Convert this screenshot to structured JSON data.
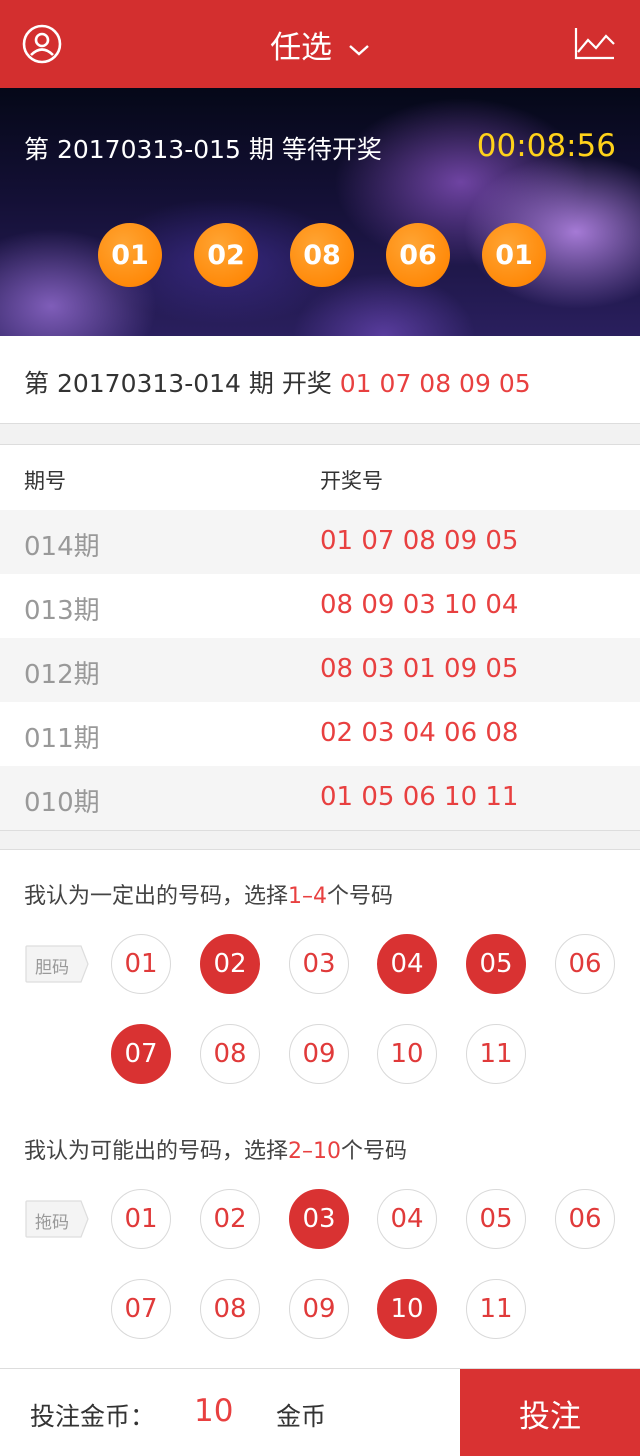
{
  "header": {
    "title": "任选"
  },
  "banner": {
    "period_text": "第 20170313-015 期 等待开奖",
    "countdown": "00:08:56",
    "balls": [
      "01",
      "02",
      "08",
      "06",
      "01"
    ]
  },
  "last_result": {
    "prefix": "第 20170313-014 期 开奖 ",
    "numbers": "01 07 08 09 05"
  },
  "history": {
    "col_period": "期号",
    "col_numbers": "开奖号",
    "rows": [
      {
        "period": "014期",
        "numbers": "01 07 08 09 05"
      },
      {
        "period": "013期",
        "numbers": "08 09 03 10 04"
      },
      {
        "period": "012期",
        "numbers": "08 03 01 09 05"
      },
      {
        "period": "011期",
        "numbers": "02 03 04 06 08"
      },
      {
        "period": "010期",
        "numbers": "01 05 06 10 11"
      }
    ]
  },
  "dan": {
    "hint_prefix": "我认为一定出的号码，选择",
    "hint_range": "1–4",
    "hint_suffix": "个号码",
    "tag": "胆码",
    "numbers": [
      {
        "n": "01",
        "selected": false
      },
      {
        "n": "02",
        "selected": true
      },
      {
        "n": "03",
        "selected": false
      },
      {
        "n": "04",
        "selected": true
      },
      {
        "n": "05",
        "selected": true
      },
      {
        "n": "06",
        "selected": false
      },
      {
        "n": "07",
        "selected": true
      },
      {
        "n": "08",
        "selected": false
      },
      {
        "n": "09",
        "selected": false
      },
      {
        "n": "10",
        "selected": false
      },
      {
        "n": "11",
        "selected": false
      }
    ]
  },
  "tuo": {
    "hint_prefix": "我认为可能出的号码，选择",
    "hint_range": "2–10",
    "hint_suffix": "个号码",
    "tag": "拖码",
    "numbers": [
      {
        "n": "01",
        "selected": false
      },
      {
        "n": "02",
        "selected": false
      },
      {
        "n": "03",
        "selected": true
      },
      {
        "n": "04",
        "selected": false
      },
      {
        "n": "05",
        "selected": false
      },
      {
        "n": "06",
        "selected": false
      },
      {
        "n": "07",
        "selected": false
      },
      {
        "n": "08",
        "selected": false
      },
      {
        "n": "09",
        "selected": false
      },
      {
        "n": "10",
        "selected": true
      },
      {
        "n": "11",
        "selected": false
      }
    ]
  },
  "footer": {
    "label": "投注金币：",
    "amount": "10",
    "unit": "金币",
    "bet_button": "投注"
  },
  "colors": {
    "brand": "#d32f2f",
    "accent_red": "#e84040",
    "ball_orange": "#ff8a0a",
    "countdown": "#ffd21a"
  },
  "icons": {
    "left": "user-icon",
    "title_arrow": "chevron-down-icon",
    "right": "trend-chart-icon"
  }
}
